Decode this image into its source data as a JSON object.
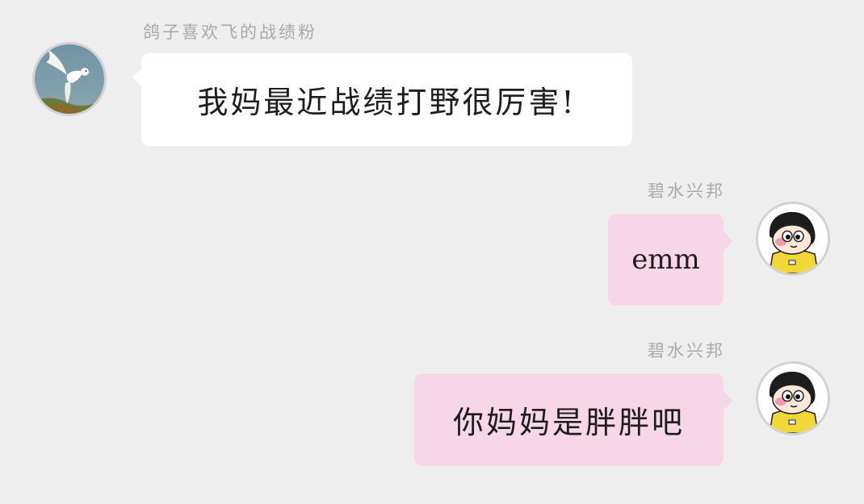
{
  "messages": [
    {
      "side": "left",
      "sender": "鸽子喜欢飞的战绩粉",
      "text": "我妈最近战绩打野很厉害!",
      "avatar_icon": "dove-avatar"
    },
    {
      "side": "right",
      "sender": "碧水兴邦",
      "text": "emm",
      "avatar_icon": "cartoon-boy-avatar"
    },
    {
      "side": "right",
      "sender": "碧水兴邦",
      "text": "你妈妈是胖胖吧",
      "avatar_icon": "cartoon-boy-avatar"
    }
  ],
  "colors": {
    "background": "#eeeeef",
    "bubble_left": "#ffffff",
    "bubble_right": "#f6d6e7",
    "sender_name": "#a9a9ab"
  }
}
